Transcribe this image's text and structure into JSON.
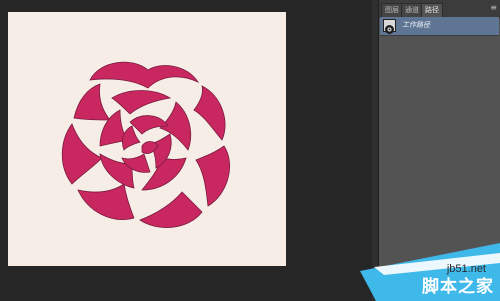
{
  "panel": {
    "tabs": [
      {
        "label": "图层",
        "active": false
      },
      {
        "label": "通道",
        "active": false
      },
      {
        "label": "路径",
        "active": true
      }
    ],
    "menu_icon": "panel-menu-icon",
    "paths": [
      {
        "name": "工作路径",
        "selected": true,
        "thumbnail_icon": "rose-thumbnail-icon"
      }
    ]
  },
  "canvas": {
    "background_color": "#f6eee6",
    "artwork_color": "#c8285f",
    "artwork": "rose-icon"
  },
  "watermark": {
    "url": "jb51.net",
    "brand": "脚本之家"
  },
  "colors": {
    "panel_bg": "#535353",
    "selection": "#5f7594",
    "workspace_bg": "#262626"
  }
}
